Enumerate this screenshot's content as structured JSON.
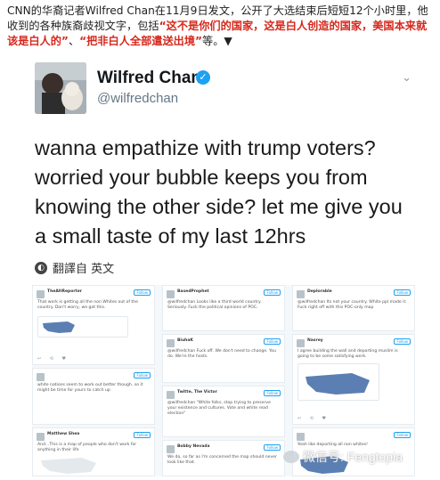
{
  "caption": {
    "part1": "CNN的华裔记者Wilfred Chan在11月9日发文，公开了大选结束后短短12个小时里，他收到的各种族裔歧视文字，包括",
    "red1": "“这不是你们的国家，这是白人创造的国家，美国本来就该是白人的”",
    "sep": "、",
    "red2": "“把非白人全部遣送出境”",
    "tail": "等。▼"
  },
  "tweet": {
    "name": "Wilfred Chan",
    "verified_glyph": "✓",
    "handle": "@wilfredchan",
    "caret": "⌄",
    "text": "wanna empathize with trump voters? worried your bubble keeps you from knowing the other side? let me give you a small taste of my last 12hrs",
    "translate_label": "翻譯自 英文"
  },
  "screenshots": {
    "follow_label": "Follow",
    "col1": [
      {
        "name": "TheAltReporter",
        "text": "That work is getting all the non Whites out of the country. Don't worry, we got this."
      },
      {
        "name": "",
        "text": "white nations seem to work out better though. so it might be time for yours to catch up"
      },
      {
        "name": "Matthew Shea",
        "text": "And...This is a map of people who don't work for anything in their life"
      }
    ],
    "col2": [
      {
        "name": "BasedProphet",
        "text": "@wilfredchan Looks like a third world country. Seriously. Fuck the political opinions of POC."
      },
      {
        "name": "BiuhaK",
        "text": "@wilfredchan Fuck off. We don't need to change. You do. We're the hosts."
      },
      {
        "name": "Twitte, The Victor",
        "text": "@wilfredchan \"White folks, stop trying to preserve your existence and cultures. Vote and white read election\""
      },
      {
        "name": "Bobby Nevada",
        "text": "We do, so far as I'm concerned the map should never look like that."
      }
    ],
    "col3": [
      {
        "name": "Deplorable",
        "text": "@wilfredchan Its not your country. White ppl made it. Fuck right off with this POC-only map"
      },
      {
        "name": "Nasrey",
        "text": "I agree building the wall and deporting muslim is going to be some satisfying work."
      },
      {
        "name": "",
        "text": "Yeah like deporting all non whites!"
      }
    ]
  },
  "watermark": "微信号: Fengtopia"
}
